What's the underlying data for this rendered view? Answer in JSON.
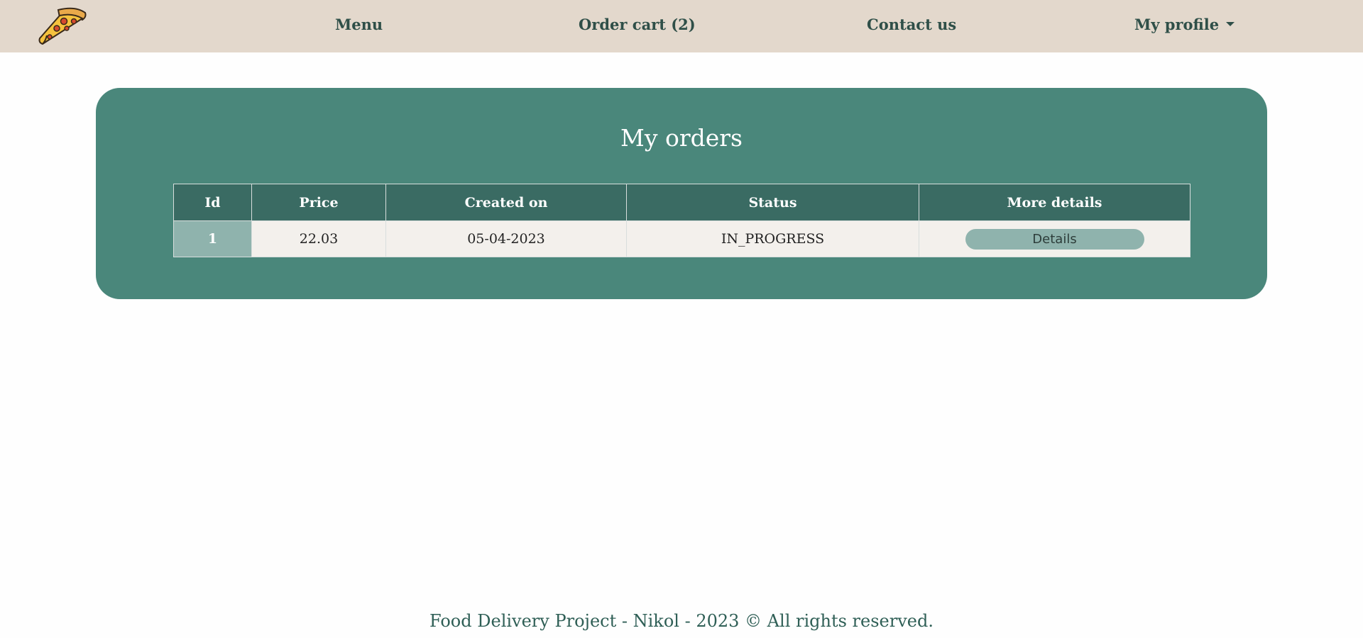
{
  "navbar": {
    "logo": "pizza-slice-icon",
    "links": {
      "menu": "Menu",
      "order_cart": "Order cart (2)",
      "contact": "Contact us",
      "profile": "My profile"
    }
  },
  "main": {
    "title": "My orders",
    "table": {
      "headers": [
        "Id",
        "Price",
        "Created on",
        "Status",
        "More details"
      ],
      "rows": [
        {
          "id": "1",
          "price": "22.03",
          "created_on": "05-04-2023",
          "status": "IN_PROGRESS",
          "details_label": "Details"
        }
      ]
    }
  },
  "footer": {
    "text": "Food Delivery Project - Nikol - 2023 © All rights reserved."
  },
  "colors": {
    "navbar_bg": "#e3d8cc",
    "panel_bg": "#4a877b",
    "table_header_bg": "#3a6b63",
    "accent_light": "#8fb3ad"
  }
}
